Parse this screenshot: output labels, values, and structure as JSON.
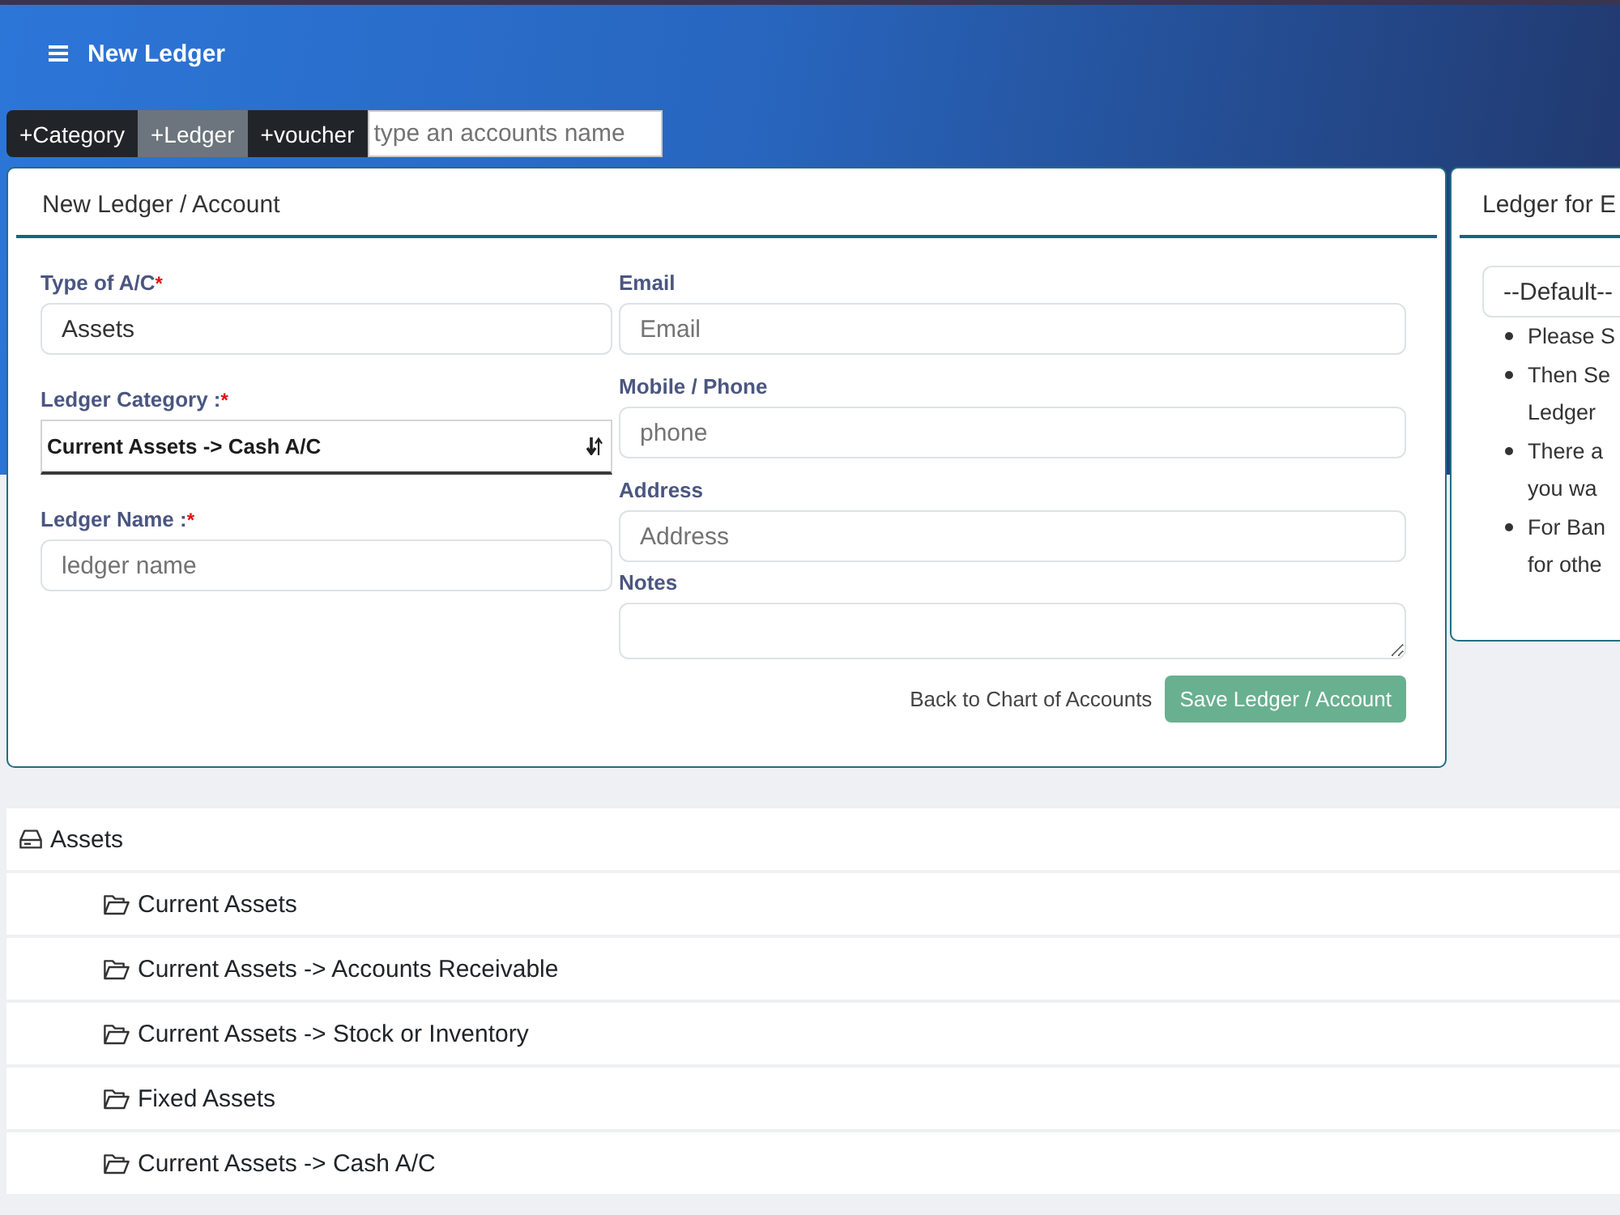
{
  "header": {
    "title": "New Ledger"
  },
  "toolbar": {
    "buttons": [
      {
        "label": "+Category",
        "selected": false
      },
      {
        "label": "+Ledger",
        "selected": true
      },
      {
        "label": "+voucher",
        "selected": false
      }
    ],
    "search": {
      "placeholder": "type an accounts name"
    }
  },
  "ledger_form": {
    "title": "New Ledger / Account",
    "left_fields": [
      {
        "kind": "input",
        "label": "Type of A/C",
        "required_mark": "*",
        "value": "Assets"
      },
      {
        "kind": "select",
        "label": "Ledger Category :",
        "required_mark": "*",
        "value": "Current Assets -> Cash A/C"
      },
      {
        "kind": "input",
        "label": "Ledger Name :",
        "required_mark": "*",
        "placeholder": "ledger name"
      }
    ],
    "right_fields": [
      {
        "kind": "input",
        "label": "Email",
        "placeholder": "Email"
      },
      {
        "kind": "input",
        "label": "Mobile / Phone",
        "placeholder": "phone"
      },
      {
        "kind": "input",
        "label": "Address",
        "placeholder": "Address"
      },
      {
        "kind": "textarea",
        "label": "Notes"
      }
    ],
    "back_link": "Back to Chart of Accounts",
    "save_button": {
      "label": "Save Ledger / Account",
      "disabled": true
    }
  },
  "help_panel": {
    "title": "Ledger for E",
    "select": {
      "value": "--Default--"
    },
    "tips": [
      {
        "lines": [
          "Please S"
        ]
      },
      {
        "lines": [
          "Then Se",
          "Ledger"
        ]
      },
      {
        "lines": [
          "There a",
          "you wa"
        ]
      },
      {
        "lines": [
          "For Ban",
          "for othe"
        ]
      }
    ]
  },
  "tree": [
    {
      "label": "Assets",
      "children": [
        {
          "label": "Current Assets"
        },
        {
          "label": "Current Assets -> Accounts Receivable"
        },
        {
          "label": "Current Assets -> Stock or Inventory"
        },
        {
          "label": "Fixed Assets"
        },
        {
          "label": "Current Assets -> Cash A/C"
        }
      ]
    }
  ]
}
